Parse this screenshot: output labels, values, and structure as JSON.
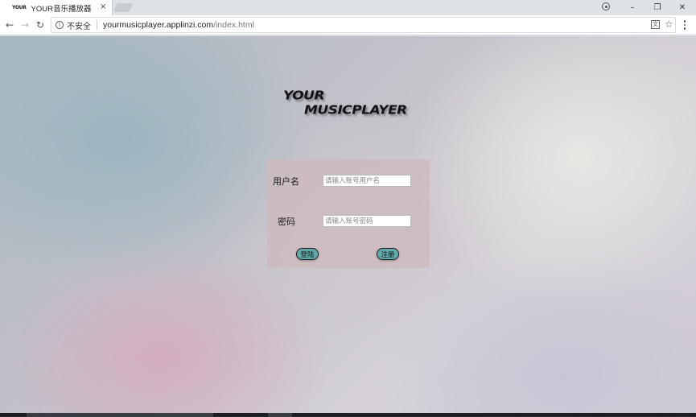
{
  "browser": {
    "tab": {
      "favicon_text": "YOUR",
      "title": "YOUR音乐播放器",
      "close_glyph": "×"
    },
    "window_controls": {
      "minimize": "–",
      "restore": "❐",
      "close": "✕"
    },
    "nav": {
      "back": "←",
      "forward": "→",
      "reload": "↻"
    },
    "omnibox": {
      "info_glyph": "i",
      "security_label": "不安全",
      "url_host": "yourmusicplayer.applinzi.com",
      "url_path": "/index.html",
      "translate_glyph": "文",
      "star_glyph": "☆"
    }
  },
  "page": {
    "logo": {
      "line1": "YOUR",
      "line2": "MUSICPLAYER"
    },
    "login": {
      "username_label": "用户名",
      "username_placeholder": "请输入账号用户名",
      "username_value": "",
      "password_label": "密码",
      "password_placeholder": "请输入账号密码",
      "password_value": "",
      "login_button": "登陆",
      "register_button": "注册"
    }
  },
  "colors": {
    "button_fill": "#63a9a9",
    "panel_bg": "#cdbabe"
  }
}
